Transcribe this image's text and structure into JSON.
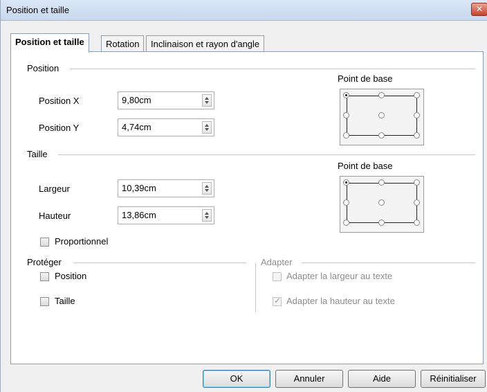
{
  "window": {
    "title": "Position et taille",
    "close_label": "✕"
  },
  "tabs": [
    {
      "label": "Position et taille",
      "active": true
    },
    {
      "label": "Rotation",
      "active": false
    },
    {
      "label": "Inclinaison et rayon d'angle",
      "active": false
    }
  ],
  "position": {
    "section_label": "Position",
    "x_label": "Position X",
    "x_value": "9,80cm",
    "y_label": "Position Y",
    "y_value": "4,74cm",
    "basepoint_label": "Point de base"
  },
  "size": {
    "section_label": "Taille",
    "width_label": "Largeur",
    "width_value": "10,39cm",
    "height_label": "Hauteur",
    "height_value": "13,86cm",
    "basepoint_label": "Point de base",
    "proportional_label": "Proportionnel"
  },
  "protect": {
    "section_label": "Protéger",
    "position_label": "Position",
    "size_label": "Taille"
  },
  "adapt": {
    "section_label": "Adapter",
    "fit_width_label": "Adapter la largeur au texte",
    "fit_height_label": "Adapter la hauteur au texte"
  },
  "buttons": {
    "ok": "OK",
    "cancel": "Annuler",
    "help": "Aide",
    "reset": "Réinitialiser"
  },
  "colors": {
    "accent": "#3c7fb1",
    "close": "#c7432c"
  }
}
